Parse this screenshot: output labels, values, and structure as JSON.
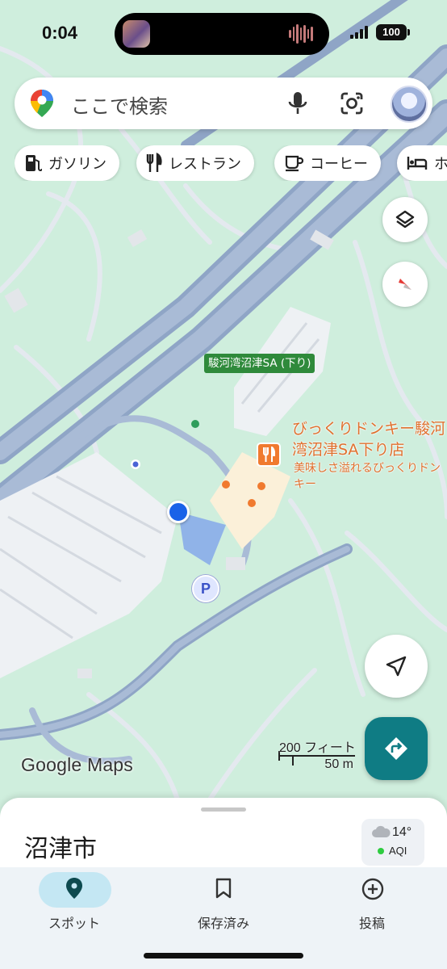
{
  "status_bar": {
    "time": "0:04",
    "battery": "100"
  },
  "search": {
    "placeholder": "ここで検索"
  },
  "chips": [
    {
      "label": "ガソリン",
      "icon": "gas-station-icon"
    },
    {
      "label": "レストラン",
      "icon": "restaurant-icon"
    },
    {
      "label": "コーヒー",
      "icon": "coffee-icon"
    },
    {
      "label": "ホ",
      "icon": "hotel-icon"
    }
  ],
  "map": {
    "sa_label": "駿河湾沼津SA (下り)",
    "poi_title": "びっくりドンキー駿河湾沼津SA下り店",
    "poi_subtitle": "美味しさ溢れるびっくりドンキー",
    "parking_label": "P",
    "scale_feet": "200 フィート",
    "scale_meters": "50 m",
    "logo": "Google Maps"
  },
  "sheet": {
    "city": "沼津市",
    "weather": {
      "temp": "14°",
      "aqi": "AQI"
    }
  },
  "bottom_nav": [
    {
      "label": "スポット",
      "icon": "location-pin-icon",
      "active": true
    },
    {
      "label": "保存済み",
      "icon": "bookmark-icon",
      "active": false
    },
    {
      "label": "投稿",
      "icon": "add-circle-icon",
      "active": false
    }
  ],
  "colors": {
    "map_bg": "#cfeedd",
    "highway": "#8fa5c6",
    "accent_teal": "#0f7c84",
    "poi_orange": "#e0702e",
    "sa_green": "#2f8a3b",
    "nav_active": "#c4e7f3"
  }
}
